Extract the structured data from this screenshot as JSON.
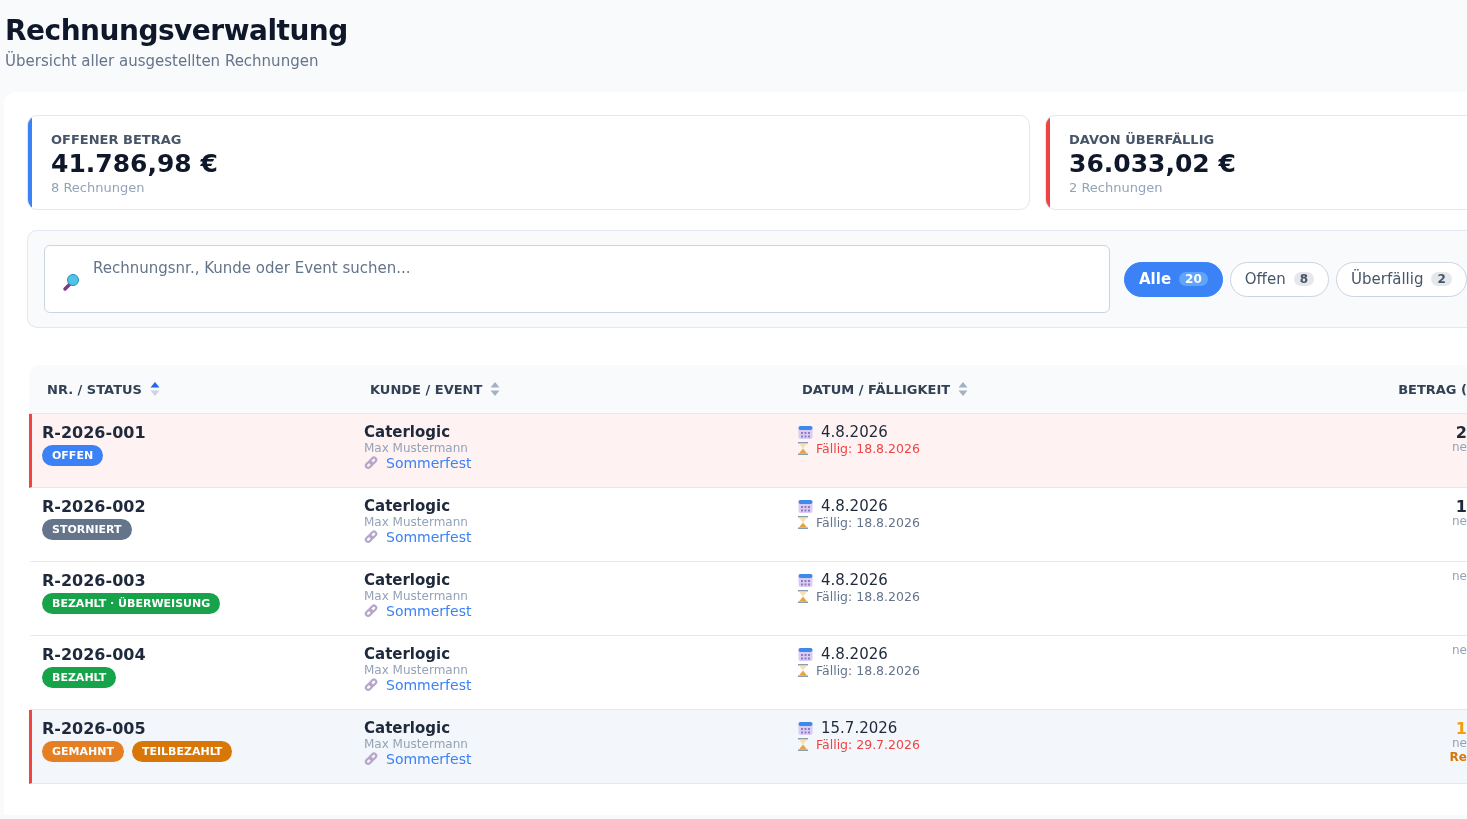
{
  "header": {
    "title": "Rechnungsverwaltung",
    "subtitle": "Übersicht aller ausgestellten Rechnungen"
  },
  "stats": [
    {
      "label": "OFFENER BETRAG",
      "value": "41.786,98 €",
      "sub": "8 Rechnungen",
      "color": "#3b82f6"
    },
    {
      "label": "DAVON ÜBERFÄLLIG",
      "value": "36.033,02 €",
      "sub": "2 Rechnungen",
      "color": "#ef4444"
    }
  ],
  "search": {
    "placeholder": "Rechnungsnr., Kunde oder Event suchen..."
  },
  "filters": [
    {
      "label": "Alle",
      "count": "20",
      "selected": true
    },
    {
      "label": "Offen",
      "count": "8",
      "selected": false
    },
    {
      "label": "Überfällig",
      "count": "2",
      "selected": false
    }
  ],
  "table": {
    "columns": [
      {
        "label": "NR. / STATUS",
        "sortable": true,
        "sorted": true
      },
      {
        "label": "KUNDE / EVENT",
        "sortable": true,
        "sorted": false
      },
      {
        "label": "DATUM / FÄLLIGKEIT",
        "sortable": true,
        "sorted": false
      },
      {
        "label": "BETRAG (",
        "sortable": false,
        "sorted": false
      }
    ],
    "rows": [
      {
        "nr": "R-2026-001",
        "badges": [
          {
            "text": "OFFEN",
            "kind": "open"
          }
        ],
        "customer": "Caterlogic",
        "contact": "Max Mustermann",
        "event": "Sommerfest",
        "date": "4.8.2026",
        "due": "Fällig: 18.8.2026",
        "overdue": true,
        "highlighted": true,
        "hovered": false,
        "amount": "2",
        "amount_warning": false,
        "net": "ne"
      },
      {
        "nr": "R-2026-002",
        "badges": [
          {
            "text": "STORNIERT",
            "kind": "cancelled"
          }
        ],
        "customer": "Caterlogic",
        "contact": "Max Mustermann",
        "event": "Sommerfest",
        "date": "4.8.2026",
        "due": "Fällig: 18.8.2026",
        "overdue": false,
        "highlighted": false,
        "hovered": false,
        "amount": "1",
        "amount_warning": false,
        "net": "ne"
      },
      {
        "nr": "R-2026-003",
        "badges": [
          {
            "text": "BEZAHLT · ÜBERWEISUNG",
            "kind": "paid"
          }
        ],
        "customer": "Caterlogic",
        "contact": "Max Mustermann",
        "event": "Sommerfest",
        "date": "4.8.2026",
        "due": "Fällig: 18.8.2026",
        "overdue": false,
        "highlighted": false,
        "hovered": false,
        "net": "ne"
      },
      {
        "nr": "R-2026-004",
        "badges": [
          {
            "text": "BEZAHLT",
            "kind": "paid"
          }
        ],
        "customer": "Caterlogic",
        "contact": "Max Mustermann",
        "event": "Sommerfest",
        "date": "4.8.2026",
        "due": "Fällig: 18.8.2026",
        "overdue": false,
        "highlighted": false,
        "hovered": false,
        "net": "ne"
      },
      {
        "nr": "R-2026-005",
        "badges": [
          {
            "text": "GEMAHNT",
            "kind": "dunned"
          },
          {
            "text": "TEILBEZAHLT",
            "kind": "partial"
          }
        ],
        "customer": "Caterlogic",
        "contact": "Max Mustermann",
        "event": "Sommerfest",
        "date": "15.7.2026",
        "due": "Fällig: 29.7.2026",
        "overdue": true,
        "highlighted": false,
        "hovered": true,
        "amount": "1",
        "amount_warning": true,
        "net": "ne",
        "note": "Re"
      }
    ]
  }
}
